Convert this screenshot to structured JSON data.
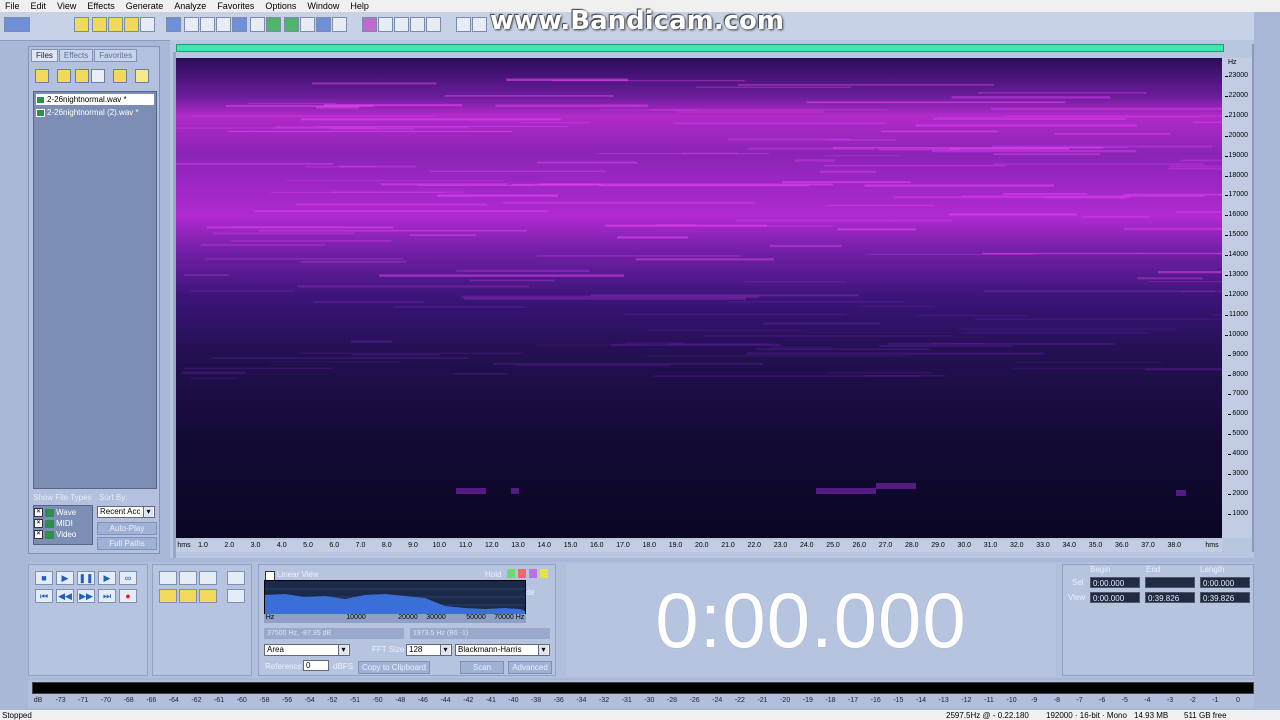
{
  "menu": [
    "File",
    "Edit",
    "View",
    "Effects",
    "Generate",
    "Analyze",
    "Favorites",
    "Options",
    "Window",
    "Help"
  ],
  "watermark": "www.Bandicam.com",
  "left_panel": {
    "tabs": [
      "Files",
      "Effects",
      "Favorites"
    ],
    "files": [
      {
        "name": "2-26nightnormal.wav *",
        "selected": true
      },
      {
        "name": "2-26nightnormal (2).wav *",
        "selected": false
      }
    ],
    "show_file_types_label": "Show File Types",
    "sort_by_label": "Sort By:",
    "file_types": [
      "Wave",
      "MIDI",
      "Video"
    ],
    "sort_value": "Recent Acc",
    "auto_play_label": "Auto-Play",
    "full_paths_label": "Full Paths"
  },
  "spectrogram": {
    "freq_unit": "Hz",
    "freq_ticks": [
      "23000",
      "22000",
      "21000",
      "20000",
      "19000",
      "18000",
      "17000",
      "16000",
      "15000",
      "14000",
      "13000",
      "12000",
      "11000",
      "10000",
      "9000",
      "8000",
      "7000",
      "6000",
      "5000",
      "4000",
      "3000",
      "2000",
      "1000"
    ],
    "time_unit": "hms",
    "time_ticks": [
      "1.0",
      "2.0",
      "3.0",
      "4.0",
      "5.0",
      "6.0",
      "7.0",
      "8.0",
      "9.0",
      "10.0",
      "11.0",
      "12.0",
      "13.0",
      "14.0",
      "15.0",
      "16.0",
      "17.0",
      "18.0",
      "19.0",
      "20.0",
      "21.0",
      "22.0",
      "23.0",
      "24.0",
      "25.0",
      "26.0",
      "27.0",
      "28.0",
      "29.0",
      "30.0",
      "31.0",
      "32.0",
      "33.0",
      "34.0",
      "35.0",
      "36.0",
      "37.0",
      "38.0"
    ],
    "colors": {
      "bg": "#0a0620",
      "band": "#c02ad8",
      "mid": "#3a1070"
    }
  },
  "fft_panel": {
    "linear_view_label": "Linear View",
    "hold_label": "Hold",
    "db_label": "dB",
    "hz_ticks": [
      "Hz",
      "10000",
      "20000",
      "30000",
      "50000",
      "70000",
      "Hz"
    ],
    "readout_left": "37500 Hz, -87.95 dB",
    "readout_right": "1973.5 Hz (B6 -1)",
    "mode": "Area",
    "fft_size_label": "FFT Size",
    "fft_size": "128",
    "window_fn": "Blackmann-Harris",
    "reference_label": "Reference",
    "reference_value": "0",
    "dbfs_label": "dBFS",
    "copy_label": "Copy to Clipboard",
    "scan_label": "Scan",
    "advanced_label": "Advanced"
  },
  "time_display": "0:00.000",
  "selection": {
    "begin_label": "Begin",
    "end_label": "End",
    "length_label": "Length",
    "sel_label": "Sel",
    "view_label": "View",
    "sel_begin": "0:00.000",
    "sel_end": "",
    "sel_length": "0:00.000",
    "view_begin": "0:00.000",
    "view_end": "0:39.826",
    "view_length": "0:39.826"
  },
  "level_meter": {
    "ticks": [
      "dB",
      "-73",
      "-71",
      "-70",
      "-68",
      "-66",
      "-64",
      "-62",
      "-61",
      "-60",
      "-58",
      "-56",
      "-54",
      "-52",
      "-51",
      "-50",
      "-48",
      "-46",
      "-44",
      "-42",
      "-41",
      "-40",
      "-38",
      "-36",
      "-34",
      "-32",
      "-31",
      "-30",
      "-28",
      "-26",
      "-24",
      "-22",
      "-21",
      "-20",
      "-19",
      "-18",
      "-17",
      "-16",
      "-15",
      "-14",
      "-13",
      "-12",
      "-11",
      "-10",
      "-9",
      "-8",
      "-7",
      "-6",
      "-5",
      "-4",
      "-3",
      "-2",
      "-1",
      "0"
    ]
  },
  "status": {
    "state": "Stopped",
    "freq": "2597.5Hz @ - 0.22.180",
    "format": "192000 · 16-bit · Mono",
    "size": "14.93 MB",
    "free": "511 GB free"
  }
}
